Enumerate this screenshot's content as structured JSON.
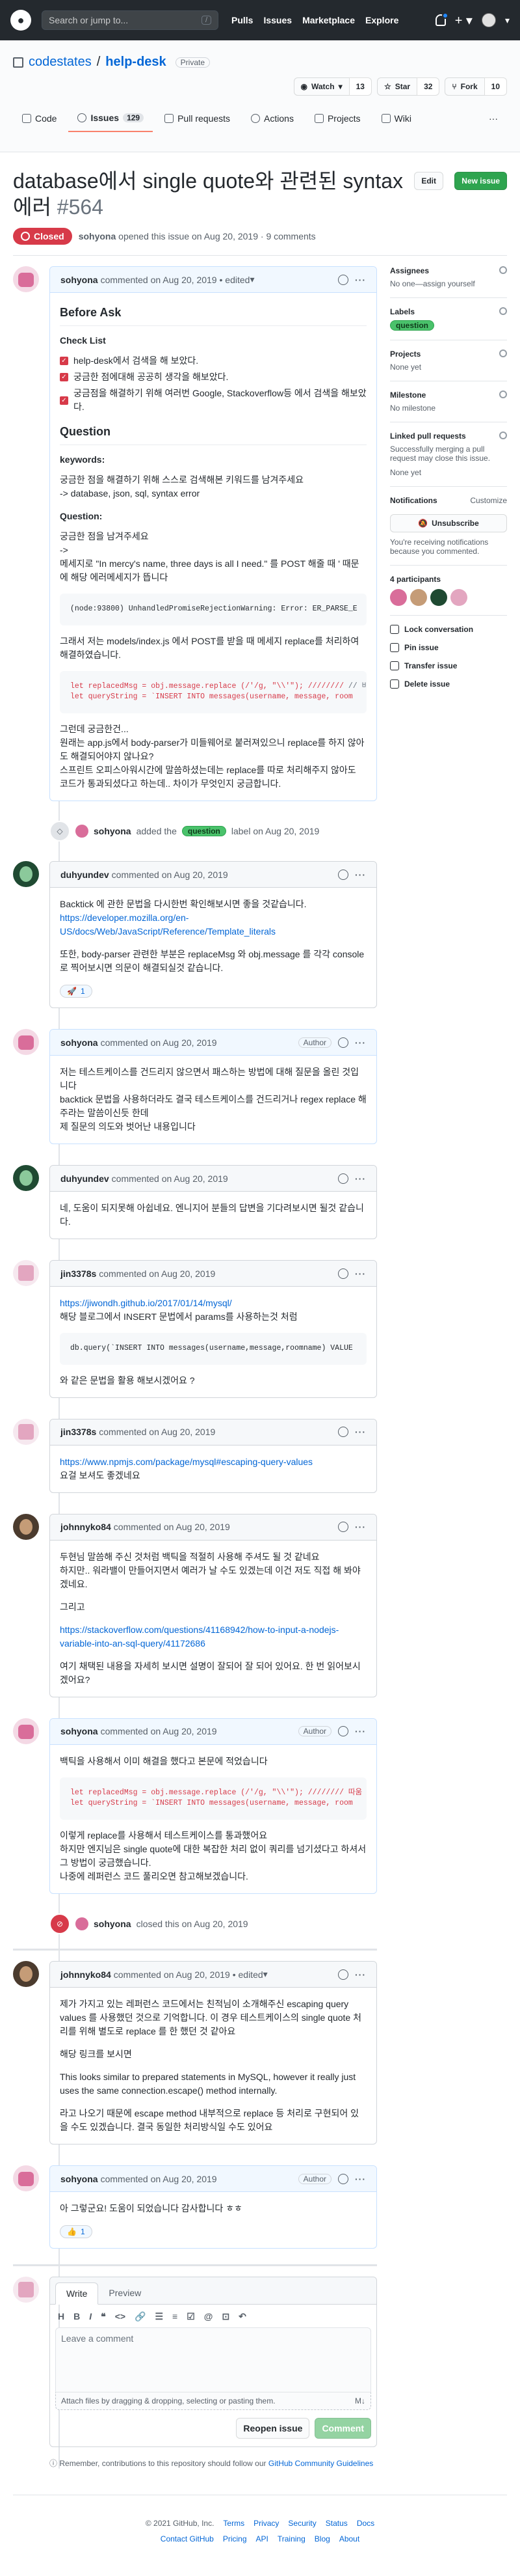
{
  "header": {
    "search_placeholder": "Search or jump to...",
    "nav": [
      "Pulls",
      "Issues",
      "Marketplace",
      "Explore"
    ]
  },
  "repo": {
    "owner": "codestates",
    "name": "help-desk",
    "visibility": "Private",
    "watch_label": "Watch",
    "watch_count": "13",
    "star_label": "Star",
    "star_count": "32",
    "fork_label": "Fork",
    "fork_count": "10",
    "tabs": [
      {
        "label": "Code"
      },
      {
        "label": "Issues",
        "count": "129"
      },
      {
        "label": "Pull requests"
      },
      {
        "label": "Actions"
      },
      {
        "label": "Projects"
      },
      {
        "label": "Wiki"
      },
      {
        "label": "···"
      }
    ]
  },
  "issue": {
    "title": "database에서 single quote와 관련된 syntax 에러",
    "number": "#564",
    "edit_label": "Edit",
    "new_issue_label": "New issue",
    "state": "Closed",
    "opener": "sohyona",
    "meta": "opened this issue on Aug 20, 2019 · 9 comments"
  },
  "comments": [
    {
      "author": "sohyona",
      "meta": "commented on Aug 20, 2019 • edited",
      "before_ask": "Before Ask",
      "checklist_title": "Check List",
      "checklist": [
        "help-desk에서 검색을 해 보았다.",
        "궁금한 점에대해 공공히 생각을 해보았다.",
        "궁금점을 해결하기 위해 여러번 Google, Stackoverflow등 에서 검색을 해보았다."
      ],
      "question_heading": "Question",
      "keywords_label": "keywords:",
      "keywords_text_1": "궁금한 점을 해결하기 위해 스스로 검색해본 키워드를 남겨주세요",
      "keywords_text_2": "-> database, json, sql, syntax error",
      "question_label": "Question:",
      "q1": "궁금한 점을 남겨주세요",
      "q2": "->",
      "q3": "메세지로 \"In mercy's name, three days is all I need.\" 를 POST 해줄 때 ' 때문에 해당 에러메세지가 뜹니다",
      "code1": "(node:93800) UnhandledPromiseRejectionWarning: Error: ER_PARSE_E",
      "q4": "그래서 저는 models/index.js 에서 POST를 받을 때 메세지 replace를 처리하여 해결하였습니다.",
      "code2_l1_a": "let replacedMsg = obj.message.replace (/'/g, \"\\\\'\"); ////////",
      "code2_l1_b": "// 바꿔",
      "code2_l2": "let queryString = `INSERT INTO messages(username, message, room",
      "q5": "그런데 궁금한건...",
      "q6": "원래는 app.js에서 body-parser가 미들웨어로 붙러져있으니 replace를 하지 않아도 해결되어야지 않나요?",
      "q7": "스프린트 오피스아워시간에 말씀하셨는데는 replace를 따로 처리해주지 않아도 코드가 통과되셨다고 하는데.. 차이가 무엇인지 궁금합니다."
    }
  ],
  "event_label": {
    "actor": "sohyona",
    "text_before": "added the",
    "label": "question",
    "text_after": "label on Aug 20, 2019"
  },
  "c2": {
    "author": "duhyundev",
    "meta": "commented on Aug 20, 2019",
    "p1": "Backtick 에 관한 문법을 다시한번 확인해보시면 좋을 것같습니다.",
    "link": "https://developer.mozilla.org/en-US/docs/Web/JavaScript/Reference/Template_literals",
    "p2": "또한, body-parser 관련한 부분은 replaceMsg 와 obj.message 를 각각 console로 찍어보시면 의문이 해결되실것 같습니다.",
    "reaction_emoji": "🚀",
    "reaction_count": "1"
  },
  "c3": {
    "author": "sohyona",
    "meta": "commented on Aug 20, 2019",
    "role": "Author",
    "p1": "저는 테스트케이스를 건드리지 않으면서 패스하는 방법에 대해 질문을 올린 것입니다",
    "p2": "backtick 문법을 사용하더라도 결국 테스트케이스를 건드리거나 regex replace 해주라는 말씀이신듯 한데",
    "p3": "제 질문의 의도와 벗어난 내용입니다"
  },
  "c4": {
    "author": "duhyundev",
    "meta": "commented on Aug 20, 2019",
    "p1": "네, 도움이 되지못해 아쉽네요. 엔니지어 분들의 답변을 기다려보시면 될것 같습니다."
  },
  "c5": {
    "author": "jin3378s",
    "meta": "commented on Aug 20, 2019",
    "link": "https://jiwondh.github.io/2017/01/14/mysql/",
    "p1": "해당 블로그에서 INSERT 문법에서 params를 사용하는것 처럼",
    "code": "db.query(`INSERT INTO messages(username,message,roomname) VALUE",
    "p2": "와 같은 문법을 활용 해보시겠어요 ?"
  },
  "c6": {
    "author": "jin3378s",
    "meta": "commented on Aug 20, 2019",
    "link": "https://www.npmjs.com/package/mysql#escaping-query-values",
    "p1": "요걸 보셔도 좋겠네요"
  },
  "c7": {
    "author": "johnnyko84",
    "meta": "commented on Aug 20, 2019",
    "p1": "두현님 말씀해 주신 것처럼 백틱을 적절히 사용해 주셔도 될 것 같네요",
    "p2": "하지만.. 워라밸이 만들어지면서 예러가 날 수도 있겠는데 이건 저도 직접 해 봐야겠네요.",
    "p3": "그리고",
    "link": "https://stackoverflow.com/questions/41168942/how-to-input-a-nodejs-variable-into-an-sql-query/41172686",
    "p4": "여기 채택된 내용을 자세히 보시면 설명이 잘되어 잘 되어 있어요. 한 번 읽어보시겠어요?"
  },
  "c8": {
    "author": "sohyona",
    "meta": "commented on Aug 20, 2019",
    "role": "Author",
    "p1": "백틱을 사용해서 이미 해결을 했다고 본문에 적었습니다",
    "code_l1": "let replacedMsg = obj.message.replace (/'/g, \"\\\\'\"); //////// 따움",
    "code_l2": "let queryString = `INSERT INTO messages(username, message, room",
    "p2": "이렇게 replace를 사용해서 테스트케이스를 통과했어요",
    "p3": "하지만 엔지님은 single quote에 대한 복잡한 처리 없이 쿼리를 넘기셨다고 하셔서 그 방법이 궁금했습니다.",
    "p4": "나중에 레퍼런스 코드 풀리오면 참고해보겠습니다."
  },
  "event_closed": {
    "actor": "sohyona",
    "text": "closed this on Aug 20, 2019"
  },
  "c9": {
    "author": "johnnyko84",
    "meta": "commented on Aug 20, 2019 • edited",
    "p1": "제가 가지고 있는 레퍼런스 코드에서는 친적님이 소개해주신 escaping query values 를 사용했던 것으로 기억합니다. 이 경우 테스트케이스의 single quote 처리를 위해 별도로 replace 를 한 했던 것 같아요",
    "p2": "해당 링크를 보시면",
    "p3": "This looks similar to prepared statements in MySQL, however it really just uses the same connection.escape() method internally.",
    "p4": "라고 나오기 때문에 escape method 내부적으로 replace 등 처리로 구현되어 있을 수도 있겠습니다. 결국 동일한 처리방식일 수도 있어요"
  },
  "c10": {
    "author": "sohyona",
    "meta": "commented on Aug 20, 2019",
    "role": "Author",
    "p1": "아 그렇군요! 도움이 되었습니다 감사합니다 ㅎㅎ",
    "reaction_emoji": "👍",
    "reaction_count": "1"
  },
  "form": {
    "write_tab": "Write",
    "preview_tab": "Preview",
    "placeholder": "Leave a comment",
    "attach": "Attach files by dragging & dropping, selecting or pasting them.",
    "reopen_label": "Reopen issue",
    "comment_label": "Comment",
    "note": "Remember, contributions to this repository should follow our",
    "note_link": "GitHub Community Guidelines"
  },
  "sidebar": {
    "assignees_title": "Assignees",
    "assignees_value": "No one—assign yourself",
    "labels_title": "Labels",
    "label_value": "question",
    "projects_title": "Projects",
    "projects_value": "None yet",
    "milestone_title": "Milestone",
    "milestone_value": "No milestone",
    "linked_title": "Linked pull requests",
    "linked_value": "Successfully merging a pull request may close this issue.",
    "linked_none": "None yet",
    "notifications_title": "Notifications",
    "customize": "Customize",
    "unsubscribe": "Unsubscribe",
    "notif_text": "You're receiving notifications because you commented.",
    "participants_title": "4 participants",
    "lock": "Lock conversation",
    "pin": "Pin issue",
    "transfer": "Transfer issue",
    "delete": "Delete issue"
  },
  "footer": {
    "copyright": "© 2021 GitHub, Inc.",
    "row1": [
      "Terms",
      "Privacy",
      "Security",
      "Status",
      "Docs"
    ],
    "row2": [
      "Contact GitHub",
      "Pricing",
      "API",
      "Training",
      "Blog",
      "About"
    ]
  },
  "colors": {
    "closed": "#d73a49",
    "label": "#4ac26b",
    "new_issue": "#2ea44f"
  }
}
